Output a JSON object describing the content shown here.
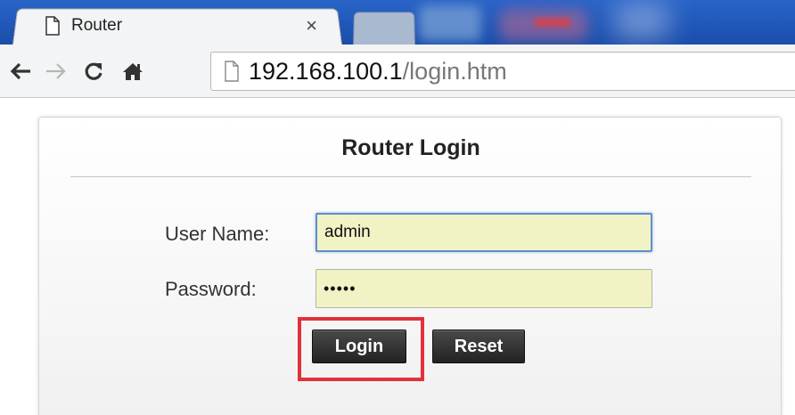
{
  "browser": {
    "active_tab": {
      "title": "Router",
      "close": "×"
    },
    "address_bar": {
      "host": "192.168.100.1",
      "path": "/login.htm"
    },
    "nav_icons": [
      "back-arrow-icon",
      "forward-arrow-icon",
      "reload-icon",
      "home-icon"
    ]
  },
  "login": {
    "title": "Router Login",
    "username_label": "User Name:",
    "username_value": "admin",
    "password_label": "Password:",
    "password_value": "•••••",
    "login_button": "Login",
    "reset_button": "Reset"
  },
  "colors": {
    "highlight": "#e0323b",
    "input_bg": "#f2f3c5",
    "button_bg": "#2a2a2a",
    "tabstrip": "#1f56b8"
  }
}
